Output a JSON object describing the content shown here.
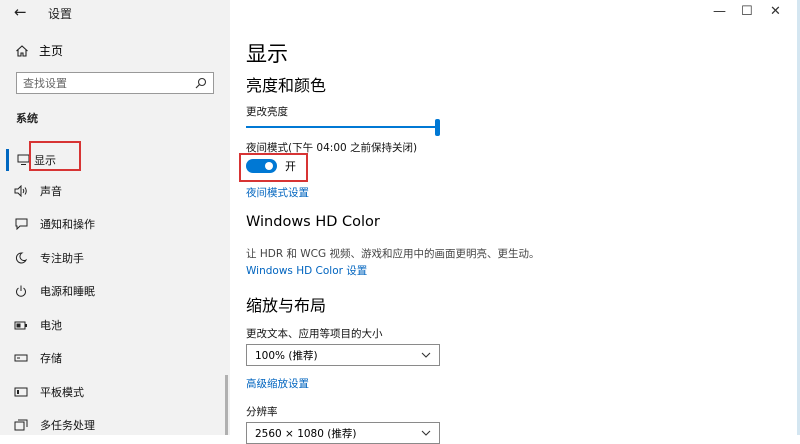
{
  "window": {
    "title": "设置"
  },
  "sidebar": {
    "home_label": "主页",
    "search_placeholder": "查找设置",
    "section_label": "系统",
    "items": [
      {
        "label": "显示",
        "icon": "monitor-icon"
      },
      {
        "label": "声音",
        "icon": "speaker-icon"
      },
      {
        "label": "通知和操作",
        "icon": "notification-icon"
      },
      {
        "label": "专注助手",
        "icon": "moon-icon"
      },
      {
        "label": "电源和睡眠",
        "icon": "power-icon"
      },
      {
        "label": "电池",
        "icon": "battery-icon"
      },
      {
        "label": "存储",
        "icon": "storage-icon"
      },
      {
        "label": "平板模式",
        "icon": "tablet-icon"
      },
      {
        "label": "多任务处理",
        "icon": "multitask-icon"
      }
    ],
    "active_item": "显示"
  },
  "main": {
    "page_title": "显示",
    "brightness": {
      "heading": "亮度和颜色",
      "slider_label": "更改亮度",
      "brightness_level": 1.0
    },
    "night_light": {
      "label": "夜间模式(下午 04:00 之前保持关闭)",
      "toggle_state": "开",
      "settings_link": "夜间模式设置"
    },
    "hdr": {
      "heading": "Windows HD Color",
      "description": "让 HDR 和 WCG 视频、游戏和应用中的画面更明亮、更生动。",
      "settings_link": "Windows HD Color 设置"
    },
    "scale": {
      "heading": "缩放与布局",
      "size_label": "更改文本、应用等项目的大小",
      "size_value": "100% (推荐)",
      "advanced_link": "高级缩放设置",
      "resolution_label": "分辨率",
      "resolution_value": "2560 × 1080 (推荐)"
    }
  },
  "colors": {
    "accent": "#0078d4",
    "link": "#0064bf",
    "highlight_box": "#d73434",
    "sidebar_bg": "#f2f2f2"
  }
}
